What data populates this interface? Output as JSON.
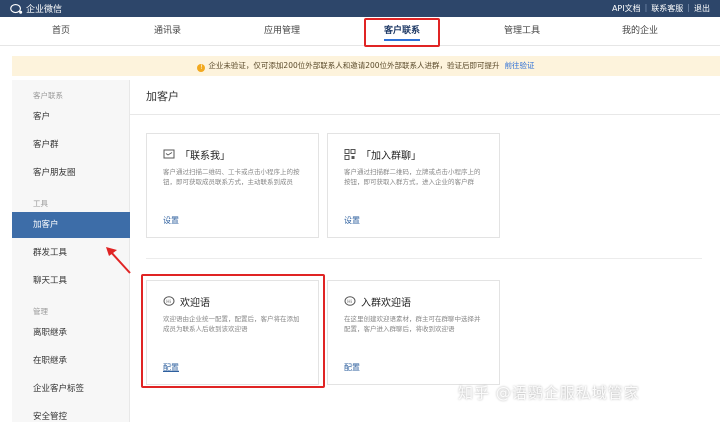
{
  "app": {
    "name": "企业微信"
  },
  "top_links": {
    "api_docs": "API文档",
    "contact_support": "联系客服",
    "logout": "退出",
    "separator": "|"
  },
  "nav": {
    "items": [
      {
        "label": "首页"
      },
      {
        "label": "通讯录"
      },
      {
        "label": "应用管理"
      },
      {
        "label": "客户联系"
      },
      {
        "label": "管理工具"
      },
      {
        "label": "我的企业"
      }
    ],
    "active_index": 3
  },
  "notice": {
    "text": "企业未验证，仅可添加200位外部联系人和邀请200位外部联系人进群，验证后即可提升",
    "link": "前往验证",
    "icon": "warning-icon"
  },
  "sidebar": {
    "groups": [
      {
        "title": "客户联系",
        "items": [
          "客户",
          "客户群",
          "客户朋友圈"
        ]
      },
      {
        "title": "工具",
        "items": [
          "加客户",
          "群发工具",
          "聊天工具"
        ]
      },
      {
        "title": "管理",
        "items": [
          "离职继承",
          "在职继承",
          "企业客户标签",
          "安全管控"
        ]
      }
    ],
    "active_item": "加客户"
  },
  "content": {
    "title": "加客户",
    "cards": [
      {
        "icon": "contact-me-icon",
        "title": "「联系我」",
        "desc": "客户通过扫描二维码、工卡或点击小程序上的按钮，即可获取成员联系方式，主动联系到成员",
        "link": "设置"
      },
      {
        "icon": "qr-code-icon",
        "title": "「加入群聊」",
        "desc": "客户通过扫描群二维码，立牌或点击小程序上的按钮，即可获取入群方式，进入企业的客户群",
        "link": "设置"
      },
      {
        "icon": "hi-greeting-icon",
        "title": "欢迎语",
        "desc": "欢迎语由企业统一配置，配置后，客户将在添加成员为联系人后收到该欢迎语",
        "link": "配置"
      },
      {
        "icon": "group-greeting-icon",
        "title": "入群欢迎语",
        "desc": "在这里创建欢迎语素材，群主可在群聊中选择并配置，客户进入群聊后，将收到欢迎语",
        "link": "配置"
      }
    ]
  },
  "watermark": {
    "text": "知乎 @语鹦企服私域管家"
  },
  "colors": {
    "topbar": "#2d466a",
    "active_sidebar": "#3d6da8",
    "highlight": "#e02424",
    "link": "#2d5f9e"
  }
}
